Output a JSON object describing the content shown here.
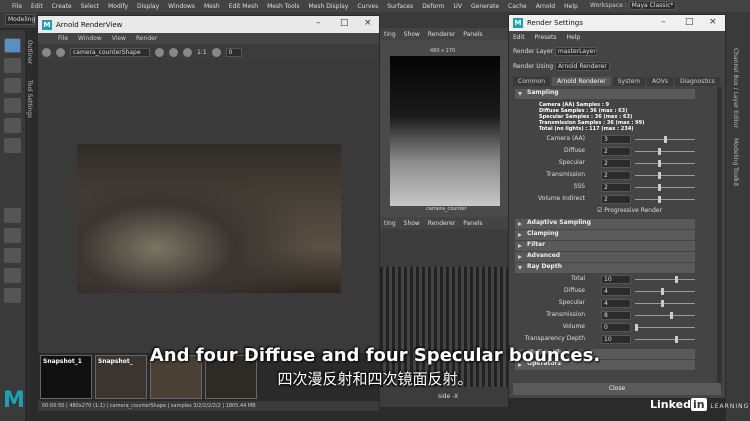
{
  "app": {
    "menu": [
      "File",
      "Edit",
      "Create",
      "Select",
      "Modify",
      "Display",
      "Windows",
      "Mesh",
      "Edit Mesh",
      "Mesh Tools",
      "Mesh Display",
      "Curves",
      "Surfaces",
      "Deform",
      "UV",
      "Generate",
      "Cache",
      "Arnold",
      "Help"
    ],
    "workspace_label": "Workspace :",
    "workspace_value": "Maya Classic*",
    "mode": "Modeling"
  },
  "side_tabs": {
    "outliner": "Outliner",
    "tool_settings": "Tool Settings",
    "channel_box": "Channel Box / Layer Editor",
    "modeling_toolkit": "Modeling Toolkit"
  },
  "render_view": {
    "title": "Arnold RenderView",
    "menu": [
      "File",
      "Window",
      "View",
      "Render"
    ],
    "camera": "camera_counterShape",
    "ratio": "1:1",
    "value": "0",
    "snapshots": [
      "Snapshot_1",
      "Snapshot_"
    ],
    "status": "00:00:50 | 480x270 (1:1) | camera_counterShape | samples 3/2/2/2/2/2 | 1805.44 MB"
  },
  "viewport_top": {
    "menu": [
      "ting",
      "Show",
      "Renderer",
      "Panels"
    ],
    "res": "480 x 270",
    "camera_label": "camera_counter"
  },
  "viewport_bottom": {
    "menu": [
      "ting",
      "Show",
      "Renderer",
      "Panels"
    ],
    "label": "side -X"
  },
  "render_settings": {
    "title": "Render Settings",
    "menu": [
      "Edit",
      "Presets",
      "Help"
    ],
    "render_layer_label": "Render Layer",
    "render_layer": "masterLayer",
    "render_using_label": "Render Using",
    "render_using": "Arnold Renderer",
    "tabs": [
      "Common",
      "Arnold Renderer",
      "System",
      "AOVs",
      "Diagnostics"
    ],
    "sampling": "Sampling",
    "info": [
      "Camera (AA) Samples : 9",
      "Diffuse Samples : 36 (max : 63)",
      "Specular Samples : 36 (max : 63)",
      "Transmission Samples : 36 (max : 99)",
      "Total (no lights) : 117 (max : 234)"
    ],
    "params": [
      {
        "label": "Camera (AA)",
        "value": "3",
        "level": 0.5
      },
      {
        "label": "Diffuse",
        "value": "2",
        "level": 0.4
      },
      {
        "label": "Specular",
        "value": "2",
        "level": 0.4
      },
      {
        "label": "Transmission",
        "value": "2",
        "level": 0.4
      },
      {
        "label": "SSS",
        "value": "2",
        "level": 0.4
      },
      {
        "label": "Volume Indirect",
        "value": "2",
        "level": 0.4
      }
    ],
    "progressive": "Progressive Render",
    "sections": [
      "Adaptive Sampling",
      "Clamping",
      "Filter",
      "Advanced"
    ],
    "ray_depth": "Ray Depth",
    "ray": [
      {
        "label": "Total",
        "value": "10",
        "level": 0.7
      },
      {
        "label": "Diffuse",
        "value": "4",
        "level": 0.45
      },
      {
        "label": "Specular",
        "value": "4",
        "level": 0.45
      },
      {
        "label": "Transmission",
        "value": "8",
        "level": 0.62
      },
      {
        "label": "Volume",
        "value": "0",
        "level": 0.0
      },
      {
        "label": "Transparency Depth",
        "value": "10",
        "level": 0.7
      }
    ],
    "more": [
      "Motion Blur",
      "Operators"
    ],
    "close": "Close"
  },
  "subtitle_en": "And four Diffuse and four Specular bounces.",
  "subtitle_zh": "四次漫反射和四次镜面反射。",
  "brand": {
    "name": "Linked",
    "in": "in",
    "learning": "LEARNING",
    "maya": "M"
  }
}
